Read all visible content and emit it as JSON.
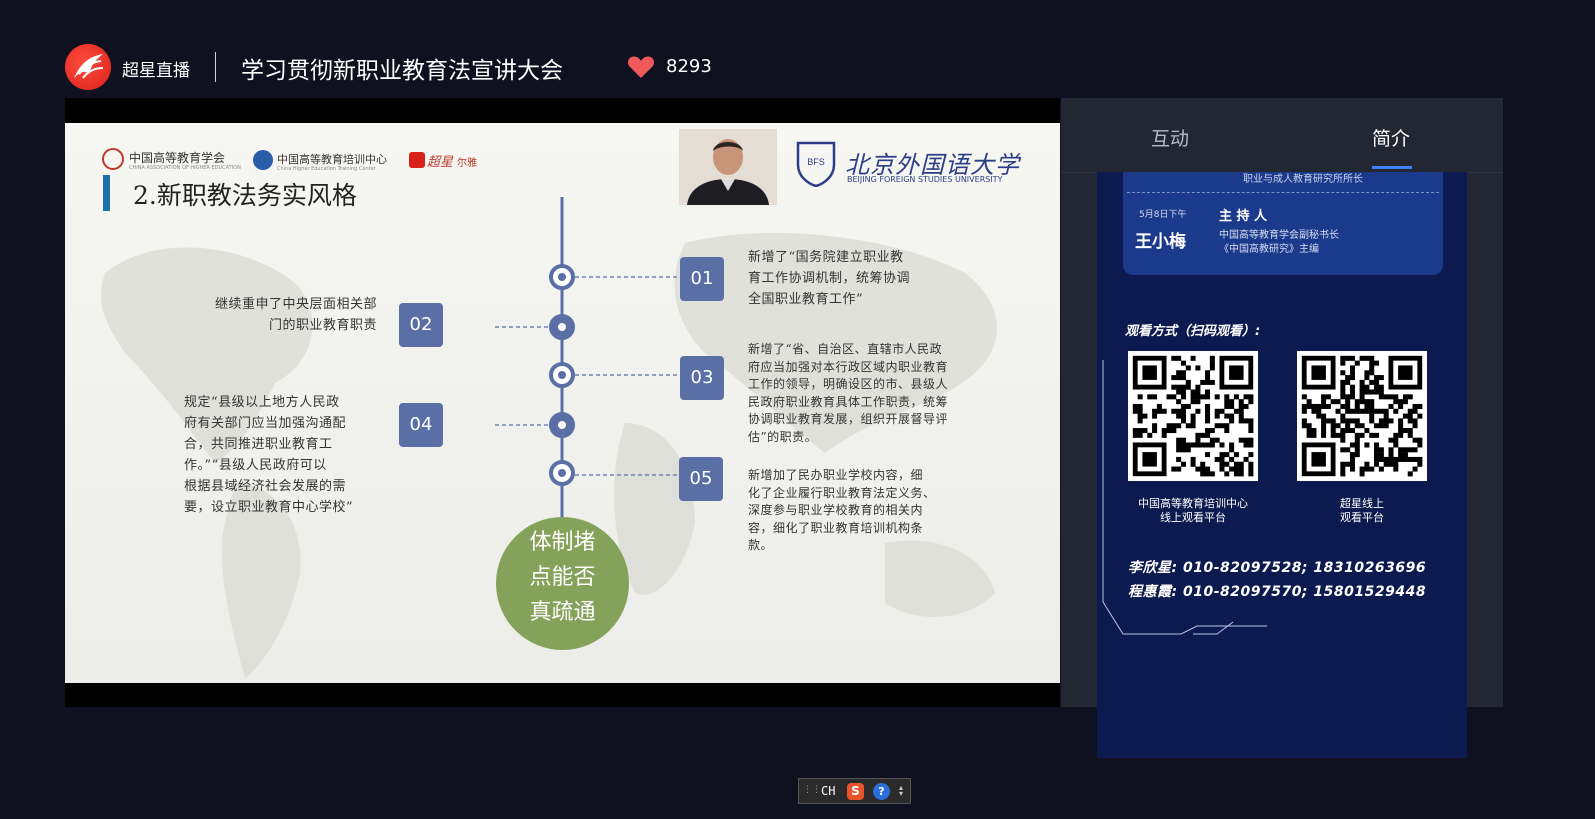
{
  "header": {
    "brand": "超星直播",
    "title": "学习贯彻新职业教育法宣讲大会",
    "likes": "8293"
  },
  "slide": {
    "orgs": {
      "cahe": "中国高等教育学会",
      "cahe_en": "CHINA ASSOCIATION OF HIGHER EDUCATION",
      "chetc": "中国高等教育培训中心",
      "chetc_en": "China Higher Education Training Center",
      "chaoxing": "超星",
      "erya": "尔雅"
    },
    "bfsu": {
      "name": "北京外国语大学",
      "en": "BEIJING FOREIGN STUDIES UNIVERSITY"
    },
    "heading": "2.新职教法务实风格",
    "items": [
      {
        "num": "01",
        "text": [
          "新增了“国务院建立职业教",
          "育工作协调机制，统筹协调",
          "全国职业教育工作”"
        ]
      },
      {
        "num": "02",
        "text": [
          "继续重申了中央层面相关部",
          "门的职业教育职责"
        ]
      },
      {
        "num": "03",
        "text": [
          "新增了“省、自治区、直辖市人民政",
          "府应当加强对本行政区域内职业教育",
          "工作的领导，明确设区的市、县级人",
          "民政府职业教育具体工作职责，统筹",
          "协调职业教育发展，组织开展督导评",
          "估”的职责。"
        ]
      },
      {
        "num": "04",
        "text": [
          "规定“县级以上地方人民政",
          "府有关部门应当加强沟通配",
          "合，共同推进职业教育工",
          "作。”“县级人民政府可以",
          "根据县域经济社会发展的需",
          "要，设立职业教育中心学校”"
        ]
      },
      {
        "num": "05",
        "text": [
          "新增加了民办职业学校内容，细",
          "化了企业履行职业教育法定义务、",
          "深度参与职业学校教育的相关内",
          "容，细化了职业教育培训机构条",
          "款。"
        ]
      }
    ],
    "circle": [
      "体制堵",
      "点能否",
      "真疏通"
    ]
  },
  "panel": {
    "tabs": {
      "interact": "互动",
      "intro": "简介"
    },
    "poster": {
      "top_line": "职业与成人教育研究所所长",
      "date": "5月8日下午",
      "host_name": "王小梅",
      "host_role": "主 持 人",
      "host_line1": "中国高等教育学会副秘书长",
      "host_line2": "《中国高教研究》主编",
      "watch_label": "观看方式（扫码观看）:",
      "qr1_caption": [
        "中国高等教育培训中心",
        "线上观看平台"
      ],
      "qr2_caption": [
        "超星线上",
        "观看平台"
      ],
      "contact1": "李欣星: 010-82097528; 18310263696",
      "contact2": "程惠霞: 010-82097570; 15801529448"
    }
  },
  "taskbar": {
    "ime": "CH"
  },
  "colors": {
    "accent": "#3b82f6",
    "slide_box": "#5b6fa7",
    "circle": "#85a25b",
    "poster_bg": "#0c1a4f"
  }
}
